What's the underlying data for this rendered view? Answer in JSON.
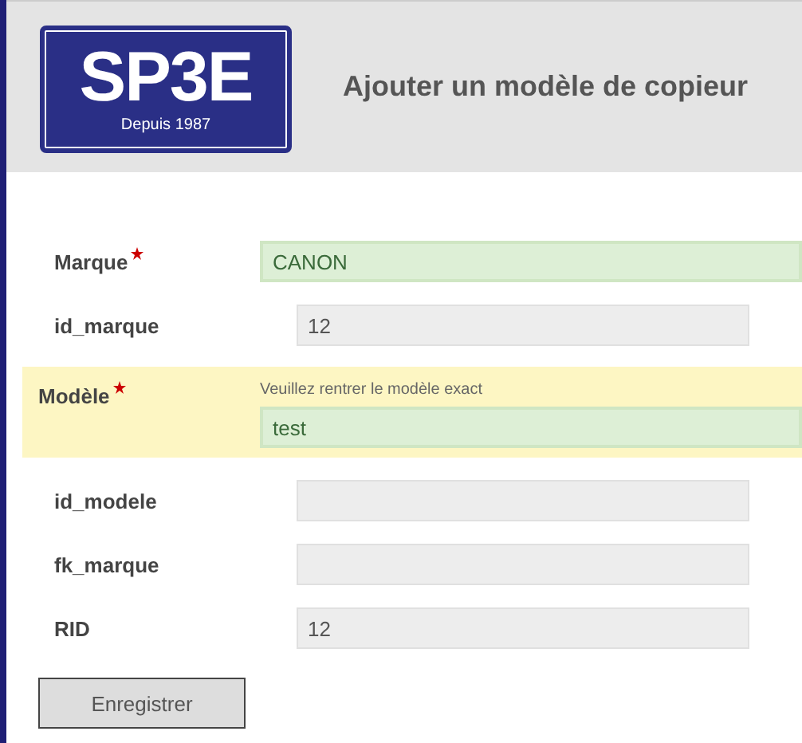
{
  "header": {
    "logo": {
      "name": "SP3E",
      "tagline": "Depuis 1987"
    },
    "title": "Ajouter un modèle de copieur"
  },
  "fields": [
    {
      "label": "Marque",
      "required": true,
      "valid": true,
      "highlighted": false,
      "value": "CANON"
    },
    {
      "label": "id_marque",
      "required": false,
      "valid": false,
      "highlighted": false,
      "value": "12"
    },
    {
      "label": "Modèle",
      "required": true,
      "valid": true,
      "highlighted": true,
      "hint": "Veuillez rentrer le modèle exact",
      "value": "test"
    },
    {
      "label": "id_modele",
      "required": false,
      "valid": false,
      "highlighted": false
    },
    {
      "label": "fk_marque",
      "required": false,
      "valid": false,
      "highlighted": false
    },
    {
      "label": "RID",
      "required": false,
      "valid": false,
      "highlighted": false,
      "value": "12"
    }
  ],
  "buttons": [
    "Enregistrer"
  ]
}
